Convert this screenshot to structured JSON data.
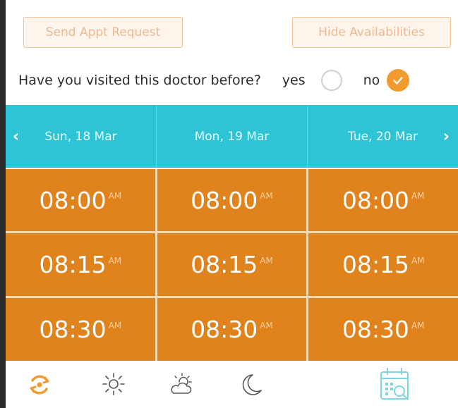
{
  "actions": {
    "send_label": "Send Appt Request",
    "hide_label": "Hide Availabilities"
  },
  "visited": {
    "question": "Have you visited this doctor before?",
    "yes_label": "yes",
    "no_label": "no",
    "selected": "no"
  },
  "dates": [
    "Sun, 18 Mar",
    "Mon, 19 Mar",
    "Tue, 20 Mar"
  ],
  "nav": {
    "prev": "‹",
    "next": "›"
  },
  "slots": [
    {
      "time": "08:00",
      "ampm": "AM"
    },
    {
      "time": "08:15",
      "ampm": "AM"
    },
    {
      "time": "08:30",
      "ampm": "AM"
    }
  ],
  "bottom_icons": [
    "all-day-icon",
    "sun-icon",
    "partly-cloudy-icon",
    "moon-icon",
    "calendar-search-icon"
  ],
  "colors": {
    "accent_orange": "#e1831d",
    "header_cyan": "#2ec4d6",
    "check_orange": "#f39a2e",
    "icon_blue": "#7fd6e3"
  }
}
